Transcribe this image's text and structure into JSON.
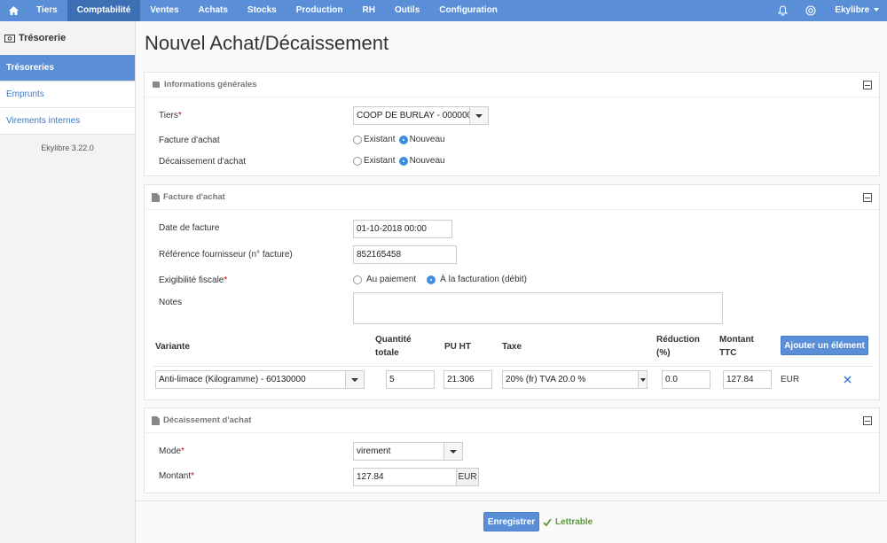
{
  "nav": {
    "items": [
      "Tiers",
      "Comptabilité",
      "Ventes",
      "Achats",
      "Stocks",
      "Production",
      "RH",
      "Outils",
      "Configuration"
    ],
    "active": "Comptabilité",
    "user": "Ekylibre"
  },
  "sidebar": {
    "title": "Trésorerie",
    "items": [
      {
        "label": "Trésoreries",
        "active": true
      },
      {
        "label": "Emprunts",
        "active": false
      },
      {
        "label": "Virements internes",
        "active": false
      }
    ],
    "version": "Ekylibre 3.22.0"
  },
  "page": {
    "title": "Nouvel Achat/Décaissement"
  },
  "general": {
    "heading": "Informations générales",
    "tiers_label": "Tiers",
    "tiers_value": "COOP DE BURLAY - 0000000",
    "invoice_label": "Facture d'achat",
    "payment_label": "Décaissement d'achat",
    "opt_existing": "Existant",
    "opt_new": "Nouveau"
  },
  "invoice": {
    "heading": "Facture d'achat",
    "date_label": "Date de facture",
    "date_value": "01-10-2018 00:00",
    "ref_label": "Référence fournisseur (n° facture)",
    "ref_value": "852165458",
    "tax_label": "Exigibilité fiscale",
    "tax_opt1": "Au paiement",
    "tax_opt2": "À la facturation (débit)",
    "notes_label": "Notes",
    "notes_value": "",
    "columns": {
      "variant": "Variante",
      "qty": "Quantité totale",
      "pu": "PU HT",
      "tax": "Taxe",
      "reduction": "Réduction (%)",
      "amount": "Montant TTC"
    },
    "add_button": "Ajouter un élément",
    "row": {
      "variant": "Anti-limace (Kilogramme) - 60130000",
      "qty": "5",
      "pu": "21.306",
      "tax": "20% (fr) TVA 20.0 %",
      "reduction": "0.0",
      "amount": "127.84",
      "currency": "EUR"
    }
  },
  "payment": {
    "heading": "Décaissement d'achat",
    "mode_label": "Mode",
    "mode_value": "virement",
    "amount_label": "Montant",
    "amount_value": "127.84",
    "currency": "EUR"
  },
  "footer": {
    "save": "Enregistrer",
    "status": "Lettrable"
  },
  "colors": {
    "nav": "#5a8fd8",
    "nav_active": "#3d6fb5",
    "link": "#3a78c3",
    "success": "#5a9a3a",
    "required": "#cc0000"
  }
}
